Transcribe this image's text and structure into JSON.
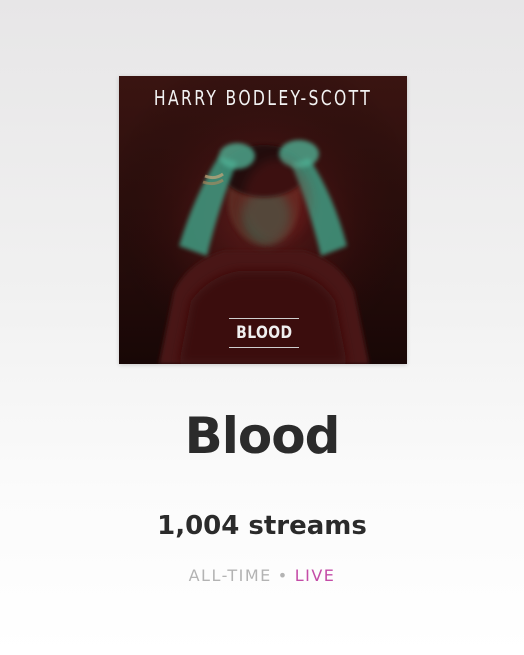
{
  "artwork": {
    "artist_text": "HARRY BODLEY-SCOTT",
    "title_text": "BLOOD"
  },
  "song": {
    "title": "Blood",
    "streams": "1,004 streams"
  },
  "filters": {
    "all_time": "ALL-TIME",
    "separator": "•",
    "live": "LIVE",
    "live_color": "#c44ca7",
    "inactive_color": "#b3b3b3"
  }
}
